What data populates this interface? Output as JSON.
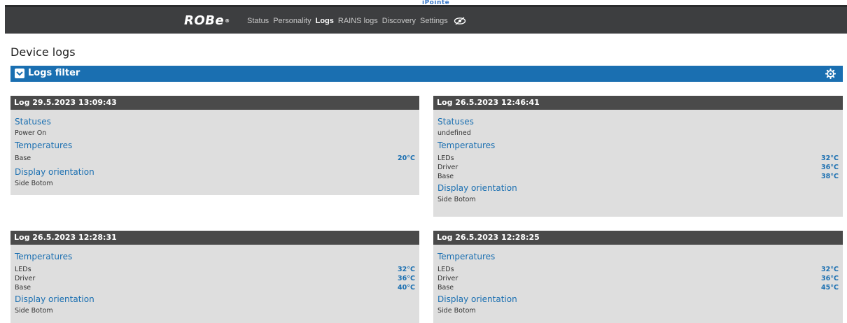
{
  "topbar": {
    "faint_text": "iPointe",
    "logo": "ROBe",
    "logo_mark": "®",
    "nav": [
      {
        "label": "Status",
        "active": false
      },
      {
        "label": "Personality",
        "active": false
      },
      {
        "label": "Logs",
        "active": true
      },
      {
        "label": "RAINS logs",
        "active": false
      },
      {
        "label": "Discovery",
        "active": false
      },
      {
        "label": "Settings",
        "active": false
      }
    ]
  },
  "page": {
    "title": "Device logs",
    "filter_label": "Logs filter"
  },
  "logs": [
    {
      "title": "Log 29.5.2023 13:09:43",
      "statuses_heading": "Statuses",
      "status": "Power On",
      "temps_heading": "Temperatures",
      "temps": [
        {
          "name": "Base",
          "value": "20°C"
        }
      ],
      "orientation_heading": "Display orientation",
      "orientation": "Side Botom"
    },
    {
      "title": "Log 26.5.2023 12:46:41",
      "statuses_heading": "Statuses",
      "status": "undefined",
      "temps_heading": "Temperatures",
      "temps": [
        {
          "name": "LEDs",
          "value": "32°C"
        },
        {
          "name": "Driver",
          "value": "36°C"
        },
        {
          "name": "Base",
          "value": "38°C"
        }
      ],
      "orientation_heading": "Display orientation",
      "orientation": "Side Botom"
    },
    {
      "title": "Log 26.5.2023 12:28:31",
      "temps_heading": "Temperatures",
      "temps": [
        {
          "name": "LEDs",
          "value": "32°C"
        },
        {
          "name": "Driver",
          "value": "36°C"
        },
        {
          "name": "Base",
          "value": "40°C"
        }
      ],
      "orientation_heading": "Display orientation",
      "orientation": "Side Botom"
    },
    {
      "title": "Log 26.5.2023 12:28:25",
      "temps_heading": "Temperatures",
      "temps": [
        {
          "name": "LEDs",
          "value": "32°C"
        },
        {
          "name": "Driver",
          "value": "36°C"
        },
        {
          "name": "Base",
          "value": "45°C"
        }
      ],
      "orientation_heading": "Display orientation",
      "orientation": "Side Botom"
    }
  ],
  "colors": {
    "accent": "#1a6fb1",
    "topbar": "#3d3e40",
    "card_header": "#4a4a4a",
    "card_body": "#dedede"
  }
}
